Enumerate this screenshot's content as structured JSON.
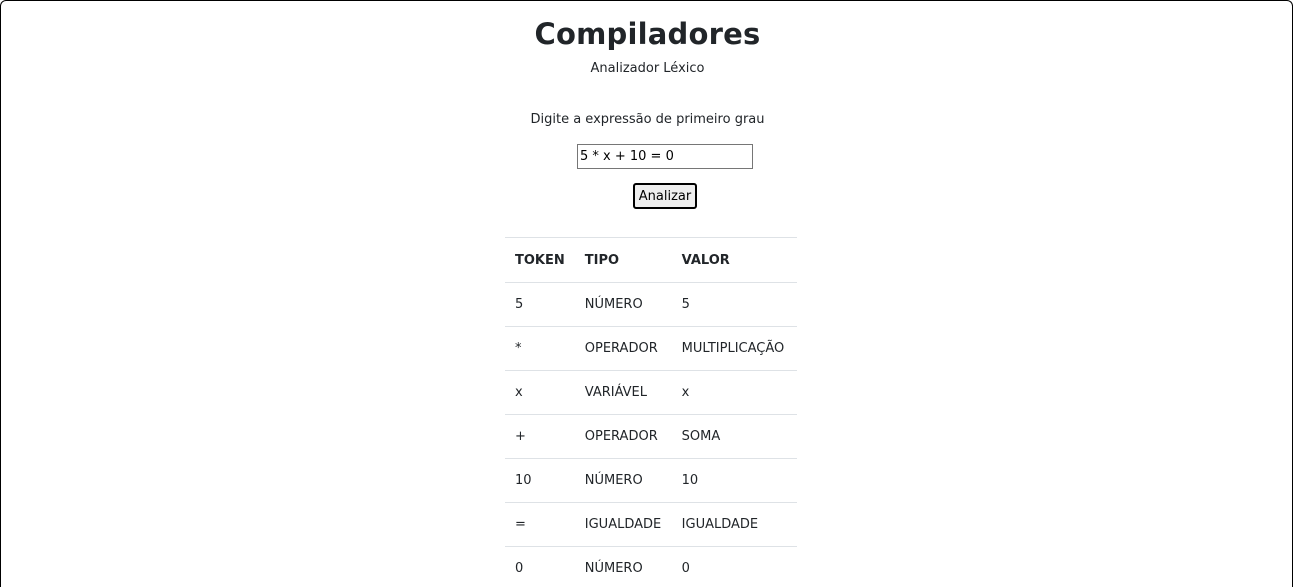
{
  "header": {
    "title": "Compiladores",
    "subtitle": "Analizador Léxico"
  },
  "form": {
    "prompt": "Digite a expressão de primeiro grau",
    "expression_value": "5 * x + 10 = 0",
    "analyze_label": "Analizar"
  },
  "table": {
    "columns": [
      "TOKEN",
      "TIPO",
      "VALOR"
    ],
    "rows": [
      {
        "token": "5",
        "tipo": "NÚMERO",
        "valor": "5"
      },
      {
        "token": "*",
        "tipo": "OPERADOR",
        "valor": "MULTIPLICAÇÃO"
      },
      {
        "token": "x",
        "tipo": "VARIÁVEL",
        "valor": "x"
      },
      {
        "token": "+",
        "tipo": "OPERADOR",
        "valor": "SOMA"
      },
      {
        "token": "10",
        "tipo": "NÚMERO",
        "valor": "10"
      },
      {
        "token": "=",
        "tipo": "IGUALDADE",
        "valor": "IGUALDADE"
      },
      {
        "token": "0",
        "tipo": "NÚMERO",
        "valor": "0"
      }
    ]
  }
}
